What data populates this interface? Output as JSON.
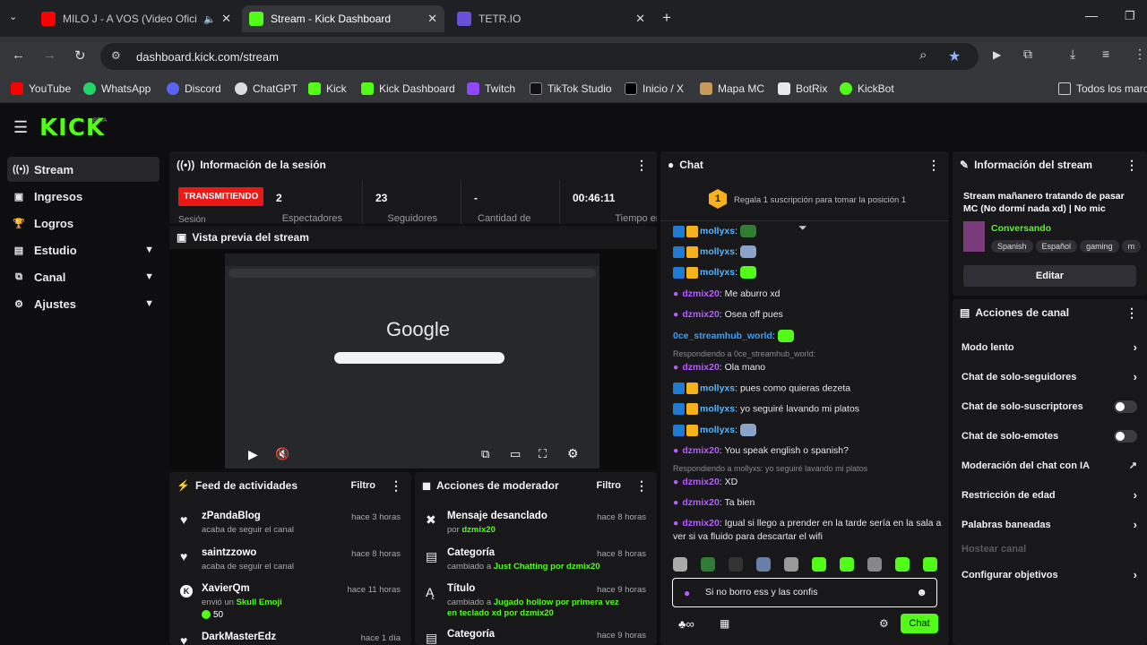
{
  "browser": {
    "tabs": [
      {
        "title": "MILO J - A VOS (Video Ofici",
        "color": "#ff0000"
      },
      {
        "title": "Stream - Kick Dashboard",
        "color": "#53fc18"
      },
      {
        "title": "TETR.IO",
        "color": "#6b4fd8"
      }
    ],
    "url": "dashboard.kick.com/stream",
    "bookmarks": [
      "YouTube",
      "WhatsApp",
      "Discord",
      "ChatGPT",
      "Kick",
      "Kick Dashboard",
      "Twitch",
      "TikTok Studio",
      "Inicio / X",
      "Mapa MC",
      "BotRix",
      "KickBot"
    ],
    "bookmarks_folder": "Todos los marc"
  },
  "brand": "KICK",
  "brand_beta": "BETA",
  "sidebar": {
    "items": [
      {
        "label": "Stream",
        "icon": "broadcast-icon"
      },
      {
        "label": "Ingresos",
        "icon": "wallet-icon"
      },
      {
        "label": "Logros",
        "icon": "trophy-icon"
      },
      {
        "label": "Estudio",
        "icon": "studio-icon",
        "chevron": true
      },
      {
        "label": "Canal",
        "icon": "channel-icon",
        "chevron": true
      },
      {
        "label": "Ajustes",
        "icon": "gear-icon",
        "chevron": true
      }
    ]
  },
  "session": {
    "title": "Información de la sesión",
    "status": "TRANSMITIENDO",
    "status_label": "Sesión",
    "viewers": "2",
    "viewers_label": "Espectadores",
    "followers": "23",
    "followers_label": "Seguidores",
    "amount": "-",
    "amount_label": "Cantidad de",
    "time": "00:46:11",
    "time_label": "Tiempo en vivo"
  },
  "preview": {
    "title": "Vista previa del stream",
    "google": "Google"
  },
  "feed": {
    "title": "Feed de actividades",
    "filter": "Filtro",
    "items": [
      {
        "name": "zPandaBlog",
        "sub": "acaba de seguir el canal",
        "time": "hace 3 horas",
        "icon": "heart-icon"
      },
      {
        "name": "saintzzowo",
        "sub": "acaba de seguir el canal",
        "time": "hace 8 horas",
        "icon": "heart-icon"
      },
      {
        "name": "XavierQm",
        "sub": "envió un ",
        "sub_hl": "Skull Emoji",
        "time": "hace 11 horas",
        "icon": "kick-icon",
        "amount": "50"
      },
      {
        "name": "DarkMasterEdz",
        "sub": "",
        "time": "hace 1 día",
        "icon": "heart-icon"
      }
    ]
  },
  "mod": {
    "title": "Acciones de moderador",
    "filter": "Filtro",
    "items": [
      {
        "name": "Mensaje desanclado",
        "pre": "por ",
        "hl": "dzmix20",
        "post": "",
        "time": "hace 8 horas",
        "icon": "unpin-icon"
      },
      {
        "name": "Categoría",
        "pre": "cambiado a ",
        "hl": "Just Chatting",
        "post": " por dzmix20",
        "time": "hace 8 horas",
        "icon": "category-icon"
      },
      {
        "name": "Título",
        "pre": "cambiado a ",
        "hl": "Jugado hollow por primera vez en teclado xd",
        "post": " por dzmix20",
        "time": "hace 9 horas",
        "icon": "title-icon"
      },
      {
        "name": "Categoría",
        "pre": "",
        "hl": "",
        "post": "",
        "time": "hace 9 horas",
        "icon": "category-icon"
      }
    ]
  },
  "chat": {
    "title": "Chat",
    "promo": "Regala 1 suscripción para tomar la posición 1",
    "promo_badge": "1",
    "messages": [
      {
        "user": "mollyxs",
        "text": "",
        "kind": "u1"
      },
      {
        "user": "mollyxs",
        "text": "",
        "kind": "u1"
      },
      {
        "user": "mollyxs",
        "text": "",
        "kind": "u1"
      },
      {
        "user": "dzmix20",
        "text": "Me aburro xd",
        "kind": "u2"
      },
      {
        "user": "dzmix20",
        "text": "Osea off pues",
        "kind": "u2"
      },
      {
        "user": "0ce_streamhub_world",
        "text": "",
        "kind": "u3"
      },
      {
        "reply": "Respondiendo a 0ce_streamhub_world:"
      },
      {
        "user": "dzmix20",
        "text": "Ola mano",
        "kind": "u2"
      },
      {
        "user": "mollyxs",
        "text": "pues como quieras dezeta",
        "kind": "u1"
      },
      {
        "user": "mollyxs",
        "text": "yo seguiré lavando mi platos",
        "kind": "u1"
      },
      {
        "user": "mollyxs",
        "text": "",
        "kind": "u1"
      },
      {
        "user": "dzmix20",
        "text": "You speak english o spanish?",
        "kind": "u2"
      },
      {
        "reply": "Respondiendo a mollyxs: yo seguiré lavando mi platos"
      },
      {
        "user": "dzmix20",
        "text": "XD",
        "kind": "u2"
      },
      {
        "user": "dzmix20",
        "text": "Ta bien",
        "kind": "u2"
      },
      {
        "user": "dzmix20",
        "text": "Igual si llego a prender en la tarde sería en la sala a",
        "kind": "u2"
      },
      {
        "cont": "ver si va fluido para descartar el wifi"
      }
    ],
    "input": "Si no borro ess y las confis",
    "send": "Chat"
  },
  "streaminfo": {
    "title": "Información del stream",
    "stream_title": "Stream mañanero tratando de pasar MC (No dormí nada xd) | No mic",
    "category": "Conversando",
    "tags": [
      "Spanish",
      "Español",
      "gaming",
      "m"
    ],
    "edit": "Editar"
  },
  "channel": {
    "title": "Acciones de canal",
    "items": [
      {
        "label": "Modo lento",
        "ctrl": "arrow"
      },
      {
        "label": "Chat de solo-seguidores",
        "ctrl": "arrow"
      },
      {
        "label": "Chat de solo-suscriptores",
        "ctrl": "toggle"
      },
      {
        "label": "Chat de solo-emotes",
        "ctrl": "toggle"
      },
      {
        "label": "Moderación del chat con IA",
        "ctrl": "ext"
      },
      {
        "label": "Restricción de edad",
        "ctrl": "arrow"
      },
      {
        "label": "Palabras baneadas",
        "ctrl": "arrow"
      },
      {
        "label": "Hostear canal",
        "ctrl": "none",
        "disabled": true
      },
      {
        "label": "Configurar objetivos",
        "ctrl": "arrow"
      }
    ]
  },
  "colors": {
    "accent": "#53fc18",
    "live": "#e91916",
    "panel": "#18181b",
    "bg": "#0e0e10"
  }
}
